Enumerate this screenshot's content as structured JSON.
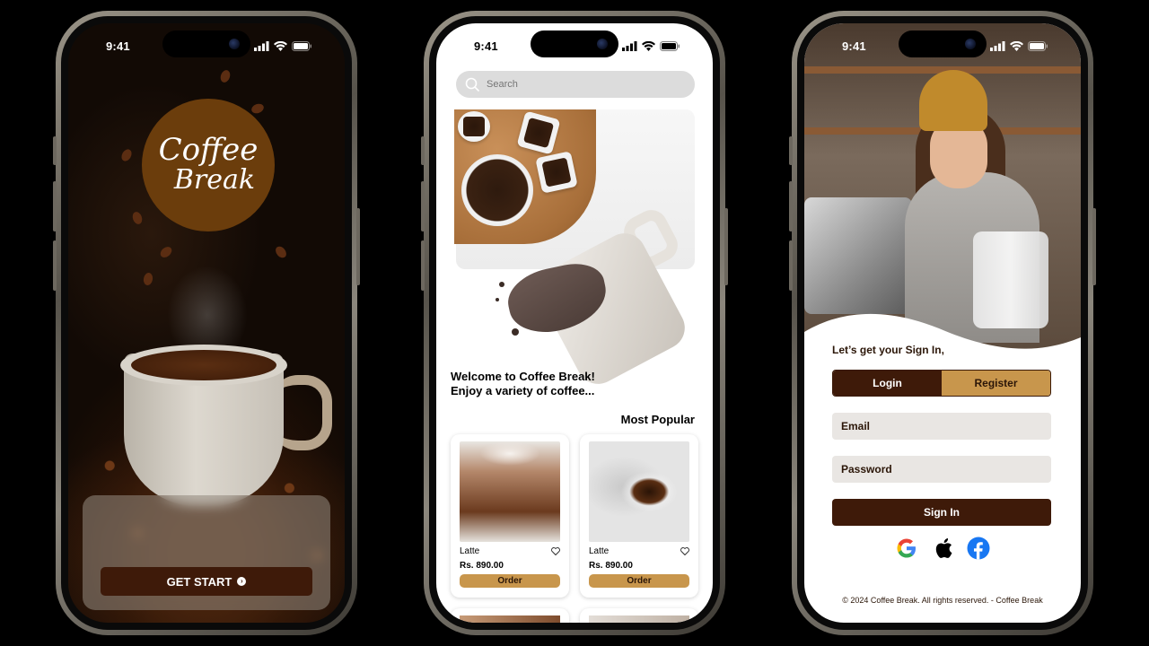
{
  "status_bar": {
    "time": "9:41"
  },
  "splash": {
    "logo_line1": "Coffee",
    "logo_line2": "Break",
    "get_start_label": "GET START"
  },
  "home": {
    "search": {
      "placeholder": "Search"
    },
    "welcome_line1": "Welcome to Coffee Break!",
    "welcome_line2": "Enjoy a variety of coffee...",
    "section_title": "Most Popular",
    "products": [
      {
        "name": "Latte",
        "price": "Rs. 890.00",
        "order_label": "Order"
      },
      {
        "name": "Latte",
        "price": "Rs. 890.00",
        "order_label": "Order"
      }
    ]
  },
  "signin": {
    "title": "Let’s get your Sign In,",
    "tabs": [
      {
        "label": "Login"
      },
      {
        "label": "Register"
      }
    ],
    "email_placeholder": "Email",
    "password_placeholder": "Password",
    "submit_label": "Sign In",
    "social": [
      "google-icon",
      "apple-icon",
      "facebook-icon"
    ],
    "footer": "© 2024 Coffee Break. All rights reserved. - Coffee Break"
  },
  "colors": {
    "brand_dark": "#3e1a09",
    "brand_gold": "#c8964c",
    "logo_brown": "#6b3d0c"
  }
}
